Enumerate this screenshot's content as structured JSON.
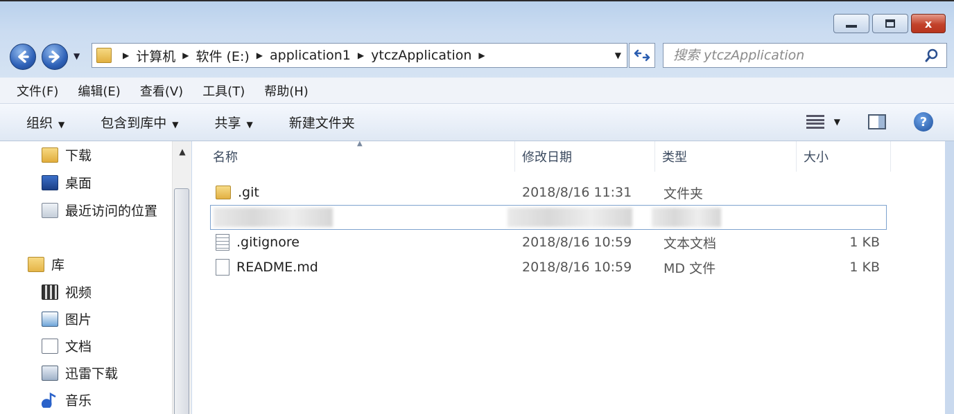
{
  "window": {
    "minimize_label": "—",
    "maximize_label": "□",
    "close_label": "x"
  },
  "address": {
    "crumbs": [
      "计算机",
      "软件 (E:)",
      "application1",
      "ytczApplication"
    ]
  },
  "search": {
    "placeholder": "搜索 ytczApplication"
  },
  "menu": {
    "items": [
      "文件(F)",
      "编辑(E)",
      "查看(V)",
      "工具(T)",
      "帮助(H)"
    ]
  },
  "commands": {
    "organize": "组织",
    "include_in_library": "包含到库中",
    "share": "共享",
    "new_folder": "新建文件夹"
  },
  "nav_pane": {
    "items": [
      {
        "label": "下载",
        "icon": "download-folder-icon"
      },
      {
        "label": "桌面",
        "icon": "desktop-icon"
      },
      {
        "label": "最近访问的位置",
        "icon": "recent-places-icon"
      },
      {
        "label": "库",
        "icon": "library-icon"
      },
      {
        "label": "视频",
        "icon": "video-icon"
      },
      {
        "label": "图片",
        "icon": "pictures-icon"
      },
      {
        "label": "文档",
        "icon": "documents-icon"
      },
      {
        "label": "迅雷下载",
        "icon": "thunder-download-icon"
      },
      {
        "label": "音乐",
        "icon": "music-icon"
      }
    ]
  },
  "file_list": {
    "columns": [
      "名称",
      "修改日期",
      "类型",
      "大小"
    ],
    "rows": [
      {
        "name": ".git",
        "date": "2018/8/16 11:31",
        "type": "文件夹",
        "size": "",
        "icon": "folder-icon"
      },
      {
        "name": ".gitignore",
        "date": "2018/8/16 10:59",
        "type": "文本文档",
        "size": "1 KB",
        "icon": "text-file-icon"
      },
      {
        "name": "README.md",
        "date": "2018/8/16 10:59",
        "type": "MD 文件",
        "size": "1 KB",
        "icon": "file-icon"
      }
    ]
  }
}
